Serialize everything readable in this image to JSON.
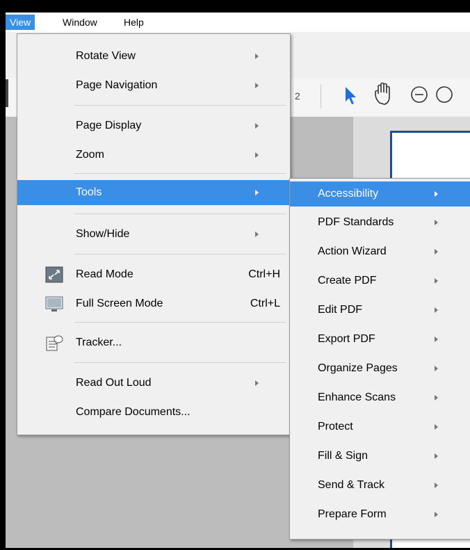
{
  "menubar": {
    "view": "View",
    "window": "Window",
    "help": "Help"
  },
  "toolbar": {
    "page_number_fragment": "2"
  },
  "view_menu": {
    "items": [
      {
        "label": "Rotate View",
        "submenu": true
      },
      {
        "label": "Page Navigation",
        "submenu": true
      },
      {
        "label": "Page Display",
        "submenu": true
      },
      {
        "label": "Zoom",
        "submenu": true
      },
      {
        "label": "Tools",
        "submenu": true,
        "active": true
      },
      {
        "label": "Show/Hide",
        "submenu": true
      },
      {
        "label": "Read Mode",
        "shortcut": "Ctrl+H",
        "icon": "read-mode-icon"
      },
      {
        "label": "Full Screen Mode",
        "shortcut": "Ctrl+L",
        "icon": "full-screen-icon"
      },
      {
        "label": "Tracker...",
        "icon": "tracker-icon"
      },
      {
        "label": "Read Out Loud",
        "submenu": true
      },
      {
        "label": "Compare Documents..."
      }
    ]
  },
  "tools_menu": {
    "items": [
      {
        "label": "Accessibility",
        "active": true
      },
      {
        "label": "PDF Standards"
      },
      {
        "label": "Action Wizard"
      },
      {
        "label": "Create PDF"
      },
      {
        "label": "Edit PDF"
      },
      {
        "label": "Export PDF"
      },
      {
        "label": "Organize Pages"
      },
      {
        "label": "Enhance Scans"
      },
      {
        "label": "Protect"
      },
      {
        "label": "Fill & Sign"
      },
      {
        "label": "Send & Track"
      },
      {
        "label": "Prepare Form"
      }
    ]
  },
  "colors": {
    "highlight": "#3a8ee6",
    "menu_bg": "#f0f0f0",
    "cursor_blue": "#1e6fd9"
  }
}
